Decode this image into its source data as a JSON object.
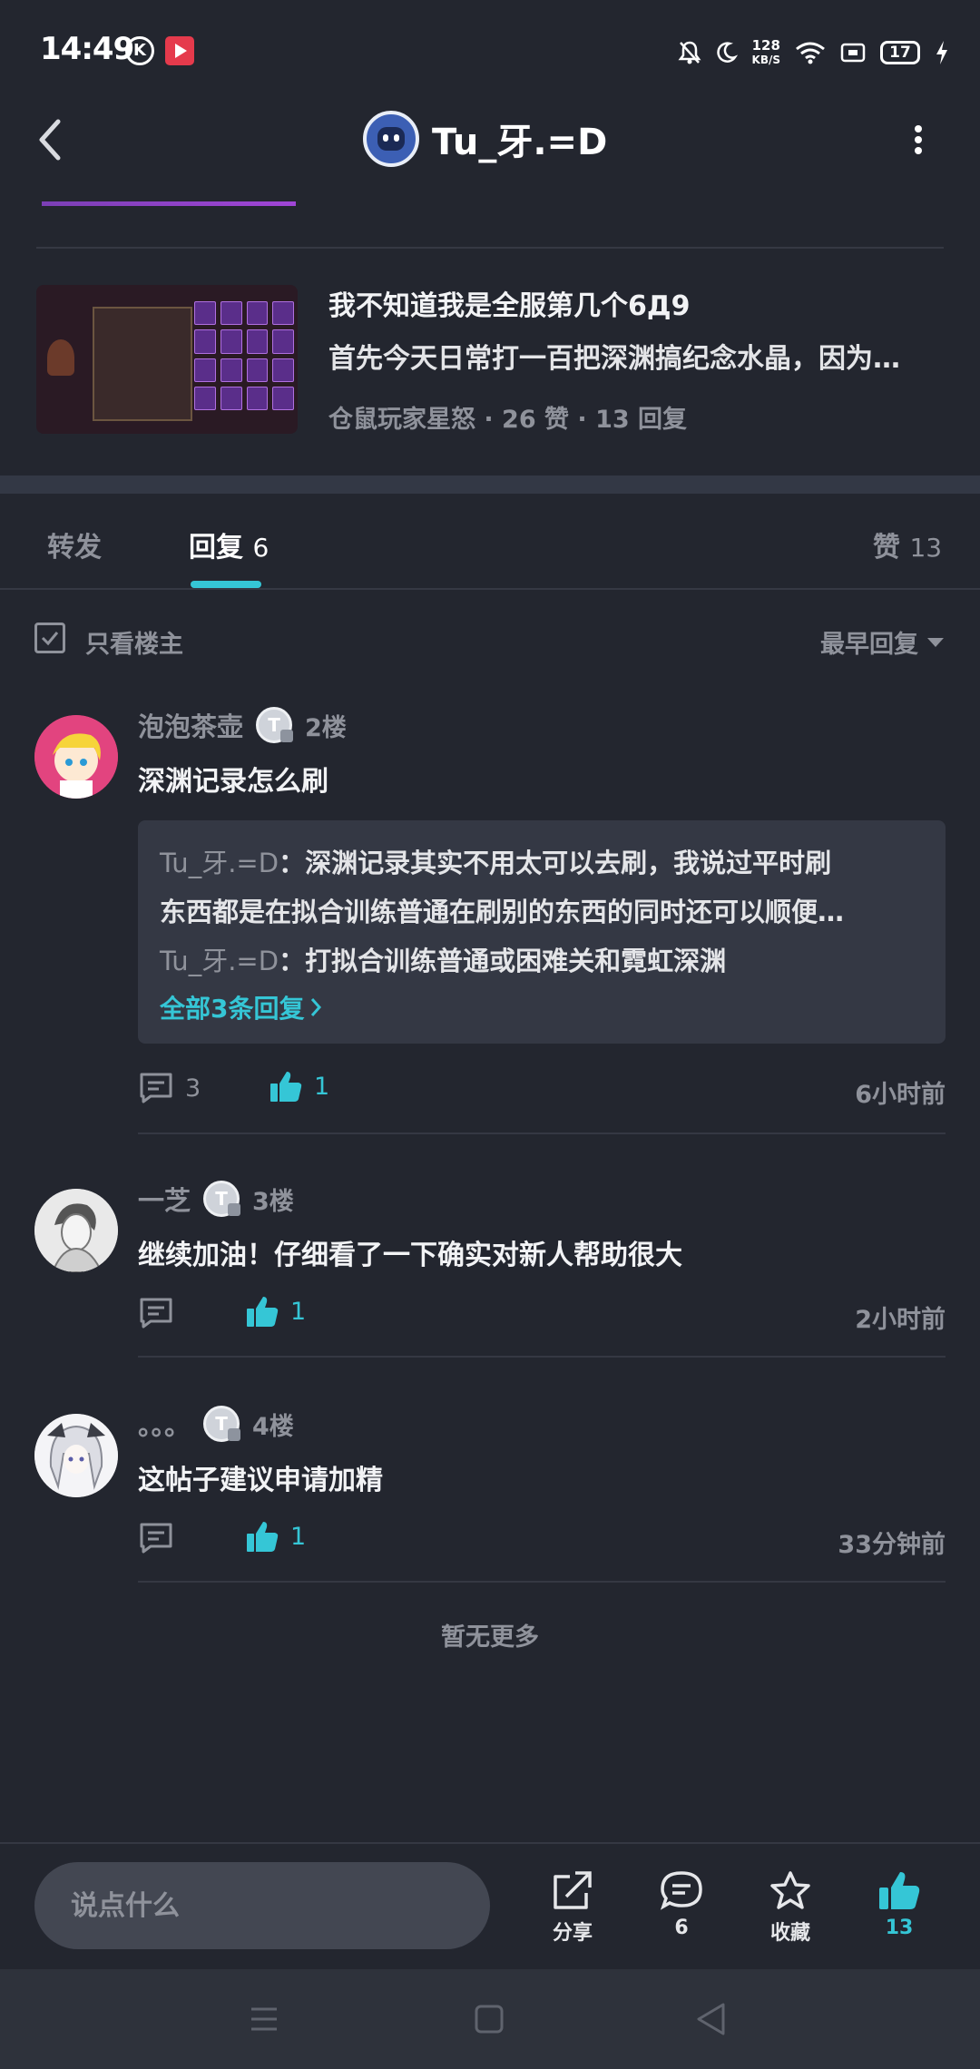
{
  "status_bar": {
    "time": "14:49",
    "k_glyph": "K",
    "speed_value": "128",
    "speed_unit": "KB/S",
    "battery": "17"
  },
  "header": {
    "title": "Tu_牙.=D"
  },
  "linked_post": {
    "title": "我不知道我是全服第几个6Д9",
    "excerpt": "首先今天日常打一百把深渊搞纪念水晶，因为…",
    "meta": "仓鼠玩家星怒 · 26 赞 · 13 回复"
  },
  "tabs": {
    "repost": "转发",
    "reply": "回复",
    "reply_count": "6",
    "like": "赞",
    "like_count": "13"
  },
  "filter": {
    "only_op": "只看楼主",
    "sort": "最早回复"
  },
  "comments": [
    {
      "user": "泡泡茶壶",
      "badge": "T",
      "floor": "2楼",
      "text": "深渊记录怎么刷",
      "replies": [
        {
          "name": "Tu_牙.=D",
          "text": "深渊记录其实不用太可以去刷，我说过平时刷"
        },
        {
          "text": "东西都是在拟合训练普通在刷别的东西的同时还可以顺便…"
        },
        {
          "name": "Tu_牙.=D",
          "text": "打拟合训练普通或困难关和霓虹深渊"
        }
      ],
      "more_replies": "全部3条回复",
      "reply_count": "3",
      "likes": "1",
      "time": "6小时前"
    },
    {
      "user": "一芝",
      "badge": "T",
      "floor": "3楼",
      "text": "继续加油！仔细看了一下确实对新人帮助很大",
      "likes": "1",
      "time": "2小时前"
    },
    {
      "user": "。。。",
      "badge": "T",
      "floor": "4楼",
      "text": "这帖子建议申请加精",
      "likes": "1",
      "time": "33分钟前"
    }
  ],
  "no_more": "暂无更多",
  "bottom_bar": {
    "input_placeholder": "说点什么",
    "share": "分享",
    "comment_count": "6",
    "favorite": "收藏",
    "like_count": "13"
  },
  "colors": {
    "background": "#23262f",
    "accent": "#35c6d6",
    "muted": "#8f929b"
  }
}
